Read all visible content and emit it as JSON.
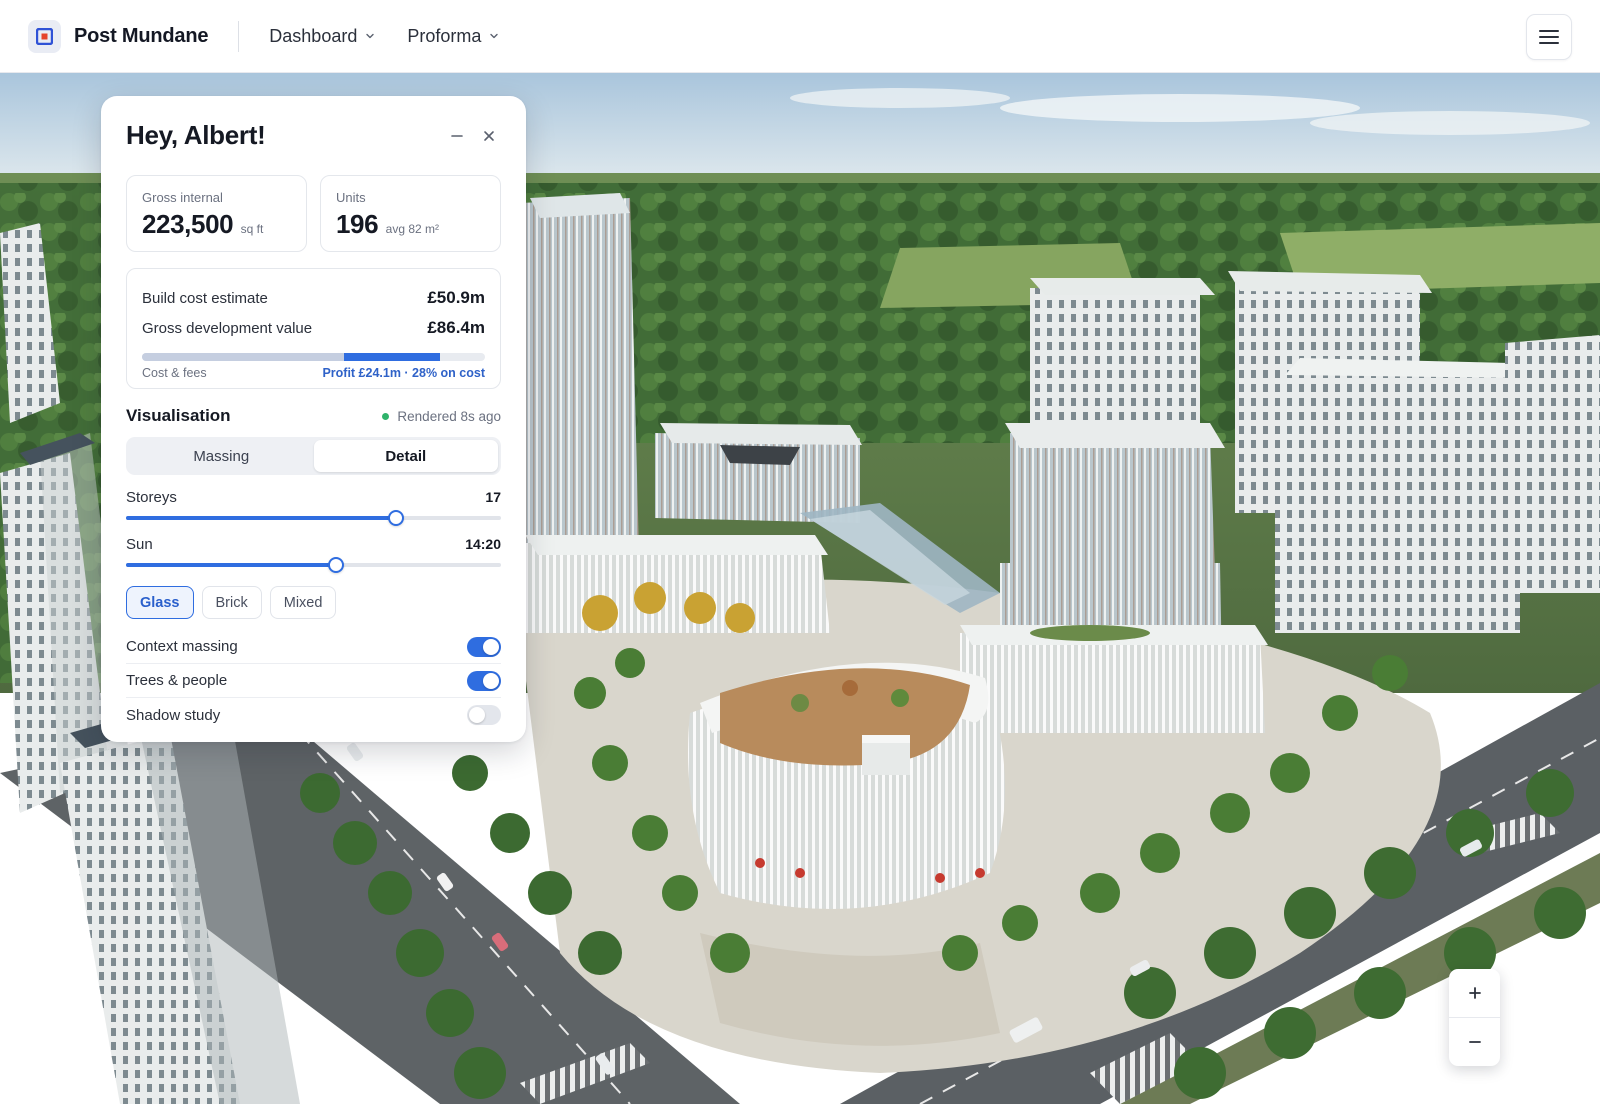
{
  "header": {
    "brand_name": "Post Mundane",
    "nav": [
      {
        "label": "Dashboard"
      },
      {
        "label": "Proforma"
      }
    ],
    "menu_icon": "hamburger-menu-icon"
  },
  "panel": {
    "greeting": "Hey, Albert!",
    "stats": {
      "gross_internal": {
        "label": "Gross internal",
        "value": "223,500",
        "unit": "sq ft"
      },
      "units": {
        "label": "Units",
        "value": "196",
        "unit": "avg 82 m²"
      }
    },
    "finance": {
      "build_cost_label": "Build cost estimate",
      "build_cost_value": "£50.9m",
      "gdv_label": "Gross development value",
      "gdv_value": "£86.4m",
      "bar": {
        "cost_fraction": 0.59,
        "profit_fraction": 0.28
      },
      "footer_left": "Cost & fees",
      "footer_right": "Profit £24.1m · 28% on cost"
    },
    "visualisation": {
      "title": "Visualisation",
      "status": "Rendered 8s ago",
      "status_color": "#2fb36b",
      "modes": [
        {
          "label": "Massing",
          "active": false
        },
        {
          "label": "Detail",
          "active": true
        }
      ],
      "storeys": {
        "label": "Storeys",
        "value": "17",
        "fraction": 0.72
      },
      "sun": {
        "label": "Sun",
        "value": "14:20",
        "fraction": 0.56
      },
      "materials": [
        {
          "label": "Glass",
          "active": true
        },
        {
          "label": "Brick",
          "active": false
        },
        {
          "label": "Mixed",
          "active": false
        }
      ],
      "toggles": [
        {
          "label": "Context massing",
          "on": true
        },
        {
          "label": "Trees & people",
          "on": true
        },
        {
          "label": "Shadow study",
          "on": false
        }
      ]
    }
  },
  "zoom": {
    "in_label": "+",
    "out_label": "−"
  },
  "colors": {
    "accent": "#2f6de0",
    "brand_logo": "#2f52d6",
    "brand_logo_inner": "#e5432c"
  }
}
